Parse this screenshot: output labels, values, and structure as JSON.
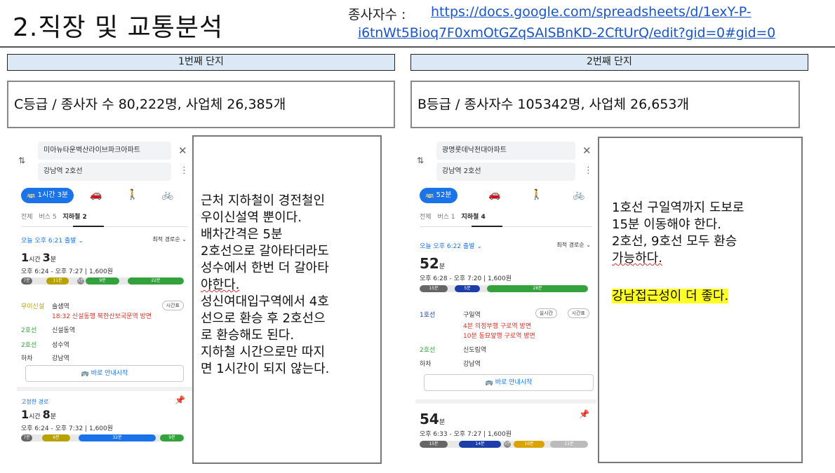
{
  "title": "2.직장 및 교통분석",
  "employees": {
    "label": "종사자수 : ",
    "url_line1": "https://docs.google.com/spreadsheets/d/1exY-P-",
    "url_line2": "i6tnWt5Bioq7F0xmOtGZqSAISBnKD-2CftUrQ/edit?gid=0#gid=0"
  },
  "complex1": {
    "header": "1번째 단지",
    "summary": "C등급 / 종사자 수 80,222명, 사업체 26,385개",
    "notes": [
      "근처 지하철이 경전철인",
      "우이신설역 뿐이다.",
      "배차간격은 5분",
      "2호선으로 갈아타더라도",
      "성수에서 한번 더 갈아타",
      "야한다.",
      "성신여대입구역에서 4호",
      "선으로 환승 후 2호선으",
      "로 환승해도 된다.",
      "지하철 시간으로만 따지",
      "면 1시간이 되지 않는다."
    ],
    "phone": {
      "origin": "미아뉴타운벽산라이브파크아파트",
      "destination": "강남역 2호선",
      "close_icon": "close-icon",
      "transit_pill": "🚌 1시간 3분",
      "tabs": [
        "전체",
        "버스 5",
        "지하철 2"
      ],
      "depart": "오늘 오후 6:21 출발 ⌄",
      "sort": "최적 경로순 ⌄",
      "duration_big": "1",
      "duration_big_unit": "시간 ",
      "duration_big2": "3",
      "duration_big2_unit": "분",
      "time_range": "오후 6:24 - 오후 7:27 | 1,600원",
      "bar_segments": [
        "7분",
        "11분",
        "5분",
        "9분",
        "22분"
      ],
      "steps": [
        {
          "line": "우이신설",
          "station": "솔샘역",
          "color": "#b7a200"
        },
        {
          "line": "",
          "station": "18:32 신설동행  북한산보국문역 방면",
          "color": "#d93025"
        },
        {
          "line": "2호선",
          "station": "신설동역",
          "color": "#33a23d"
        },
        {
          "line": "2호선",
          "station": "성수역",
          "color": "#33a23d"
        },
        {
          "line": "하차",
          "station": "강남역",
          "color": "#333333"
        }
      ],
      "timetable_chip": "시간표",
      "nav_button": "🚌 바로 안내시작",
      "fixed_label": "고정한 경로",
      "alt_big": "1",
      "alt_big_unit": "시간 ",
      "alt_big2": "8",
      "alt_big2_unit": "분",
      "alt_time_range": "오후 6:24 - 오후 7:32 | 1,600원",
      "alt_bar_segments": [
        "7분",
        "6분",
        "32분",
        "9분"
      ]
    }
  },
  "complex2": {
    "header": "2번째 단지",
    "summary": "B등급 / 종사자수 105342명, 사업체 26,653개",
    "notes": [
      "1호선 구일역까지 도보로",
      "15분 이동해야 한다.",
      "2호선, 9호선 모두 환승",
      "가능하다.",
      "",
      "강남접근성이 더 좋다."
    ],
    "phone": {
      "origin": "광명롯데낙천대아파트",
      "destination": "강남역 2호선",
      "transit_pill": "🚌 52분",
      "tabs": [
        "전체",
        "버스 1",
        "지하철 4"
      ],
      "depart": "오늘 오후 6:22 출발 ⌄",
      "sort": "최적 경로순 ⌄",
      "duration_big": "52",
      "duration_big_unit": "분",
      "time_range": "오후 6:28 - 오후 7:20 | 1,600원",
      "bar_segments": [
        "15분",
        "5분",
        "28분"
      ],
      "steps": [
        {
          "line": "1호선",
          "station": "구일역",
          "color": "#1d3ea8"
        },
        {
          "line": "",
          "station": "4분 의정부행  구로역 방면",
          "color": "#d93025"
        },
        {
          "line": "",
          "station": "10분 동묘앞행  구로역 방면",
          "color": "#d93025"
        },
        {
          "line": "2호선",
          "station": "신도림역",
          "color": "#33a23d"
        },
        {
          "line": "하차",
          "station": "강남역",
          "color": "#333333"
        }
      ],
      "realtime_chip": "실시간",
      "timetable_chip": "시간표",
      "nav_button": "🚌 바로 안내시작",
      "alt_big": "54",
      "alt_big_unit": "분",
      "alt_time_range": "오후 6:33 - 오후 7:27 | 1,600원",
      "alt_bar_segments": [
        "15분",
        "14분",
        "3분",
        "10분",
        "11분"
      ]
    }
  },
  "colors": {
    "header_bg": "#dbe8f6",
    "link": "#1a56c8",
    "highlight": "#ffff22",
    "transit_blue": "#1a73e8",
    "line2_green": "#33a23d",
    "line1_navy": "#1d3ea8",
    "uisinseol_yellow": "#b7a200"
  }
}
